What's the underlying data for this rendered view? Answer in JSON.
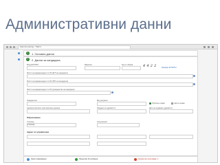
{
  "slide": {
    "title": "Административни данни"
  },
  "browser": {
    "url": "https://oo.edu.bg/...?Tab=1"
  },
  "sections": {
    "s1": {
      "number": "1",
      "title": "1. Основни данни"
    },
    "s2": {
      "number": "2",
      "title": "2. Данни за кандидата"
    }
  },
  "form": {
    "egn_label": "Вход ЕГН/ЛНЧ",
    "surname_label": "Фамилия",
    "code_label": "Код от образа",
    "captcha": "4 4 2 2",
    "check_link": "Провери ЕГН/ЛНЧ",
    "row2_label": "Място на раждане/адрес по ЛК (ЕГН на кандидата)",
    "row3_label": "Място на раждане/адрес по ЛК (ЛНЧ на кандидата)",
    "row4_label": "Място на раждане/адрес по ЛК (гражданство на кандидата)",
    "citizenship_label": "Гражданство",
    "doc_type_label": "Вид документ",
    "radio_a": "Публично право",
    "radio_b": "Частно право",
    "admin_label": "Административно-териториална единица",
    "issue_label": "Издаден на (дд/мм/гггг)",
    "date_label": "Дата на издаване (дд/мм/гггг)",
    "sub_title": "Образование",
    "school_label": "Училище",
    "school_value": "Училище",
    "spec_label": "Специалност",
    "address_title": "Адрес по управление"
  },
  "footer": {
    "btn_save": "Запис информация",
    "btn_next": "Продължи без промени",
    "status": "Грешка при попълване: 1"
  }
}
